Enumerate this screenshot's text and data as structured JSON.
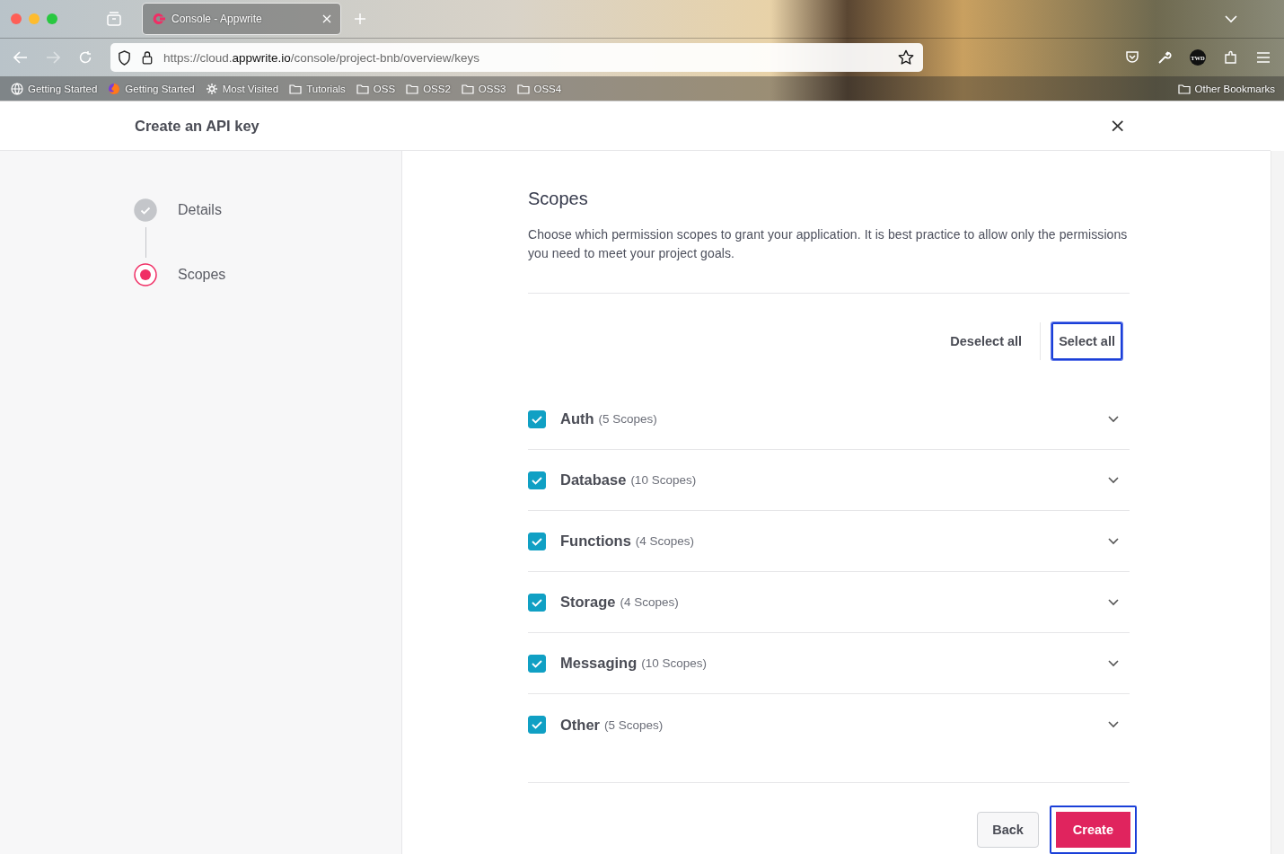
{
  "browser": {
    "tab": {
      "title": "Console - Appwrite",
      "selected": true
    },
    "url": "https://cloud.**appwrite.io**/console/project-bnb/overview/keys",
    "bookmarks": [
      {
        "label": "Getting Started",
        "kind": "globe"
      },
      {
        "label": "Getting Started",
        "kind": "firefox"
      },
      {
        "label": "Most Visited",
        "kind": "gear"
      },
      {
        "label": "Tutorials",
        "kind": "folder"
      },
      {
        "label": "OSS",
        "kind": "folder"
      },
      {
        "label": "OSS2",
        "kind": "folder"
      },
      {
        "label": "OSS3",
        "kind": "folder"
      },
      {
        "label": "OSS4",
        "kind": "folder"
      }
    ],
    "other_bookmarks": "Other Bookmarks",
    "profile_badge": "TWD"
  },
  "dialog": {
    "title": "Create an API key",
    "close": "×",
    "steps": [
      {
        "label": "Details",
        "completed": true,
        "selected": false
      },
      {
        "label": "Scopes",
        "completed": false,
        "selected": true
      }
    ],
    "heading": "Scopes",
    "description": "Choose which permission scopes to grant your application. It is best practice to allow only the permissions you need to meet your project goals.",
    "deselect_all": {
      "label": "Deselect all"
    },
    "select_all": {
      "label": "Select all",
      "focused": true
    },
    "groups": [
      {
        "name": "Auth",
        "count": "(5 Scopes)",
        "checked": true
      },
      {
        "name": "Database",
        "count": "(10 Scopes)",
        "checked": true
      },
      {
        "name": "Functions",
        "count": "(4 Scopes)",
        "checked": true
      },
      {
        "name": "Storage",
        "count": "(4 Scopes)",
        "checked": true
      },
      {
        "name": "Messaging",
        "count": "(10 Scopes)",
        "checked": true
      },
      {
        "name": "Other",
        "count": "(5 Scopes)",
        "checked": true
      }
    ],
    "back": {
      "label": "Back"
    },
    "create": {
      "label": "Create",
      "focused": true
    }
  }
}
